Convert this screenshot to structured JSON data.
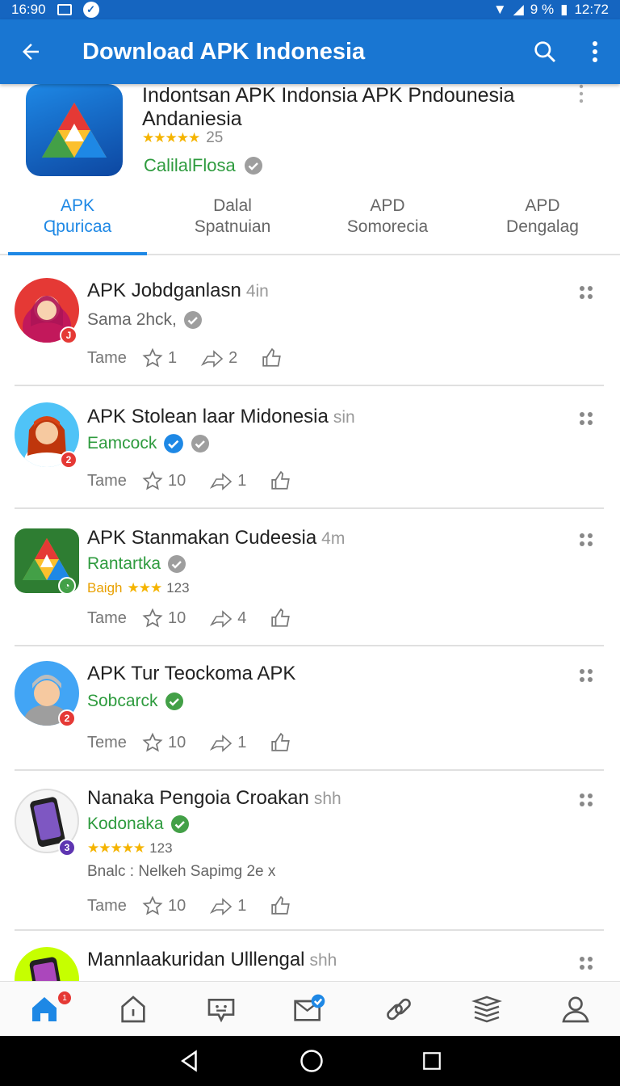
{
  "status": {
    "time_left": "16:90",
    "battery": "9 %",
    "time_right": "12:72"
  },
  "appbar": {
    "title": "Download APK Indonesia"
  },
  "app": {
    "name": "Indontsan APK Indonsia APK Pndounesia Andaniesia",
    "rating_count": "25",
    "developer": "CalilalFlosa"
  },
  "tabs": [
    {
      "line1": "APK",
      "line2": "Ɋpuricaa"
    },
    {
      "line1": "Dalal",
      "line2": "Spatnuian"
    },
    {
      "line1": "APD",
      "line2": "Somorecia"
    },
    {
      "line1": "APD",
      "line2": "Dengalag"
    }
  ],
  "items": [
    {
      "title": "APK Jobdganlasn",
      "time": "4in",
      "sub": "Sama 2hck,",
      "action_label": "Tame",
      "stars": "1",
      "shares": "2",
      "badge": "J"
    },
    {
      "title": "APK Stolean laar Midonesia",
      "time": "sin",
      "sub": "Eamcock",
      "action_label": "Tame",
      "stars": "10",
      "shares": "1",
      "badge": "2"
    },
    {
      "title": "APK Stanmakan Cudeesia",
      "time": "4m",
      "sub": "Rantartka",
      "extra_label": "Baigh",
      "extra_count": "123",
      "action_label": "Tame",
      "stars": "10",
      "shares": "4",
      "badge": ""
    },
    {
      "title": "APK Tur Teockoma APK",
      "time": "",
      "sub": "Sobcarck",
      "action_label": "Teme",
      "stars": "10",
      "shares": "1",
      "badge": "2"
    },
    {
      "title": "Nanaka Pengoia Croakan",
      "time": "shh",
      "sub": "Kodonaka",
      "extra_count": "123",
      "desc": "Bnalc : Nelkeh Sapimg 2e x",
      "action_label": "Tame",
      "stars": "10",
      "shares": "1",
      "badge": "3"
    },
    {
      "title": "Mannlaakuridan Ulllengal",
      "time": "shh"
    }
  ],
  "nav": {
    "home_badge": "1"
  },
  "colors": {
    "primary": "#1976d2",
    "accent": "#1e88e5",
    "green": "#2e9b3e",
    "star": "#f5b400"
  },
  "icons": [
    "back-arrow-icon",
    "search-icon",
    "more-vert-icon",
    "star-icon",
    "share-icon",
    "like-icon",
    "verified-icon",
    "home-icon",
    "chat-icon",
    "mail-icon",
    "link-icon",
    "layers-icon",
    "person-icon"
  ]
}
